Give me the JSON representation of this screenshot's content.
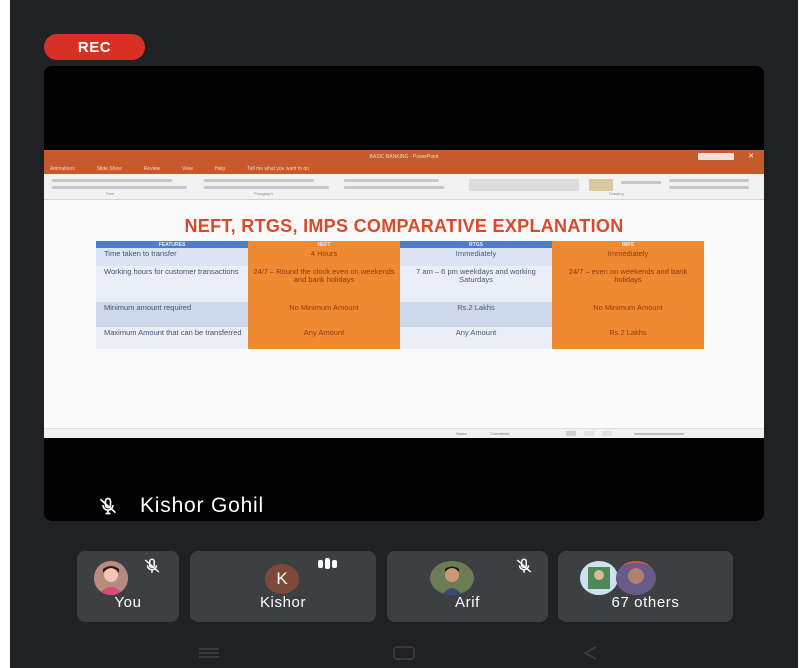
{
  "recording_badge": "REC",
  "shared_screen": {
    "app_title": "BASIC BANKING - PowerPoint",
    "menu_items": [
      "Animations",
      "Slide Show",
      "Review",
      "View",
      "Help",
      "Tell me what you want to do"
    ],
    "ribbon_groups": [
      "Font",
      "Paragraph",
      "Drawing"
    ],
    "slide": {
      "title": "NEFT, RTGS, IMPS COMPARATIVE EXPLANATION",
      "columns": [
        "FEATURES",
        "NEFT",
        "RTGS",
        "IMPS"
      ],
      "rows": [
        [
          "Time taken to transfer",
          "4 Hours",
          "Immediately",
          "Immediately"
        ],
        [
          "Working hours for customer transactions",
          "24/7 – Round the clock even on weekends and bank holidays",
          "7 am – 6 pm weekdays and working Saturdays",
          "24/7 – even on weekends and bank holidays"
        ],
        [
          "Minimum amount required",
          "No Minimum Amount",
          "Rs.2 Lakhs",
          "No Minimum Amount"
        ],
        [
          "Maximum Amount that can be transferred",
          "Any Amount",
          "Any Amount",
          "Rs.2 Lakhs"
        ]
      ]
    },
    "status": {
      "notes": "Notes",
      "comments": "Comments"
    }
  },
  "active_speaker": {
    "name": "Kishor Gohil",
    "icon": "mic-off-icon"
  },
  "participants": [
    {
      "label": "You",
      "muted": true
    },
    {
      "label": "Kishor",
      "initial": "K",
      "speaking": true,
      "avatar_color": "#7d4a3a"
    },
    {
      "label": "Arif",
      "muted": true
    },
    {
      "label": "67 others"
    }
  ],
  "colors": {
    "rec": "#d93025",
    "tile": "#3c4043",
    "background": "#202124",
    "slide_title": "#d94a2a",
    "table_orange": "#f08a32",
    "table_blue": "#4f7ec8"
  }
}
